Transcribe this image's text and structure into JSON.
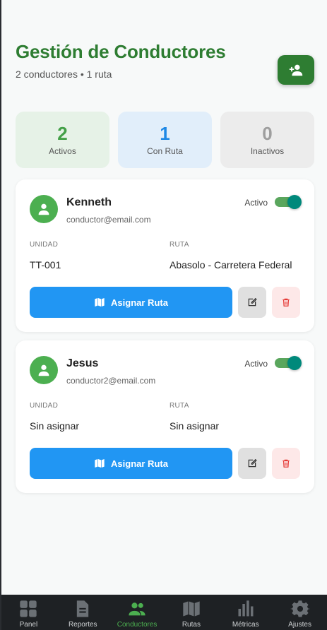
{
  "header": {
    "title": "Gestión de Conductores",
    "subtitle": "2 conductores • 1 ruta"
  },
  "stats": [
    {
      "value": "2",
      "label": "Activos"
    },
    {
      "value": "1",
      "label": "Con Ruta"
    },
    {
      "value": "0",
      "label": "Inactivos"
    }
  ],
  "drivers": [
    {
      "name": "Kenneth",
      "email": "conductor@email.com",
      "status": "Activo",
      "active": true,
      "unit_label": "UNIDAD",
      "unit": "TT-001",
      "route_label": "RUTA",
      "route": "Abasolo - Carretera Federal",
      "assign_label": "Asignar Ruta"
    },
    {
      "name": "Jesus",
      "email": "conductor2@email.com",
      "status": "Activo",
      "active": true,
      "unit_label": "UNIDAD",
      "unit": "Sin asignar",
      "route_label": "RUTA",
      "route": "Sin asignar",
      "assign_label": "Asignar Ruta"
    }
  ],
  "nav": [
    {
      "label": "Panel",
      "icon": "grid-icon"
    },
    {
      "label": "Reportes",
      "icon": "document-icon"
    },
    {
      "label": "Conductores",
      "icon": "users-icon",
      "active": true
    },
    {
      "label": "Rutas",
      "icon": "map-icon"
    },
    {
      "label": "Métricas",
      "icon": "bar-chart-icon"
    },
    {
      "label": "Ajustes",
      "icon": "gear-icon"
    }
  ],
  "colors": {
    "primary_green": "#2e7d32",
    "accent_blue": "#2196f3",
    "delete_red": "#e53935",
    "nav_background": "#1e2124"
  }
}
